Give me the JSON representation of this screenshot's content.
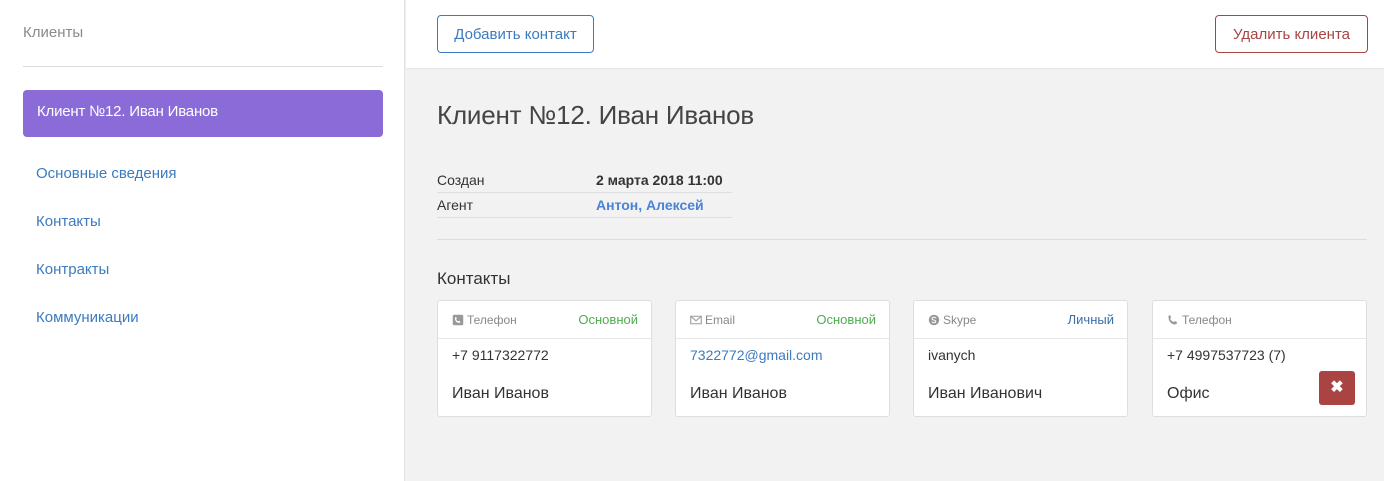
{
  "sidebar": {
    "title": "Клиенты",
    "active_client": "Клиент №12. Иван Иванов",
    "items": [
      {
        "label": "Основные сведения"
      },
      {
        "label": "Контакты"
      },
      {
        "label": "Контракты"
      },
      {
        "label": "Коммуникации"
      }
    ]
  },
  "toolbar": {
    "add_contact_label": "Добавить контакт",
    "delete_client_label": "Удалить клиента"
  },
  "main": {
    "title": "Клиент №12. Иван Иванов",
    "meta": {
      "created_label": "Создан",
      "created_value": "2 марта 2018 11:00",
      "agent_label": "Агент",
      "agent_1": "Антон",
      "agent_separator": ",",
      "agent_2": "Алексей"
    },
    "contacts_title": "Контакты",
    "contacts": [
      {
        "icon": "phone-icon",
        "type": "Телефон",
        "tag": "Основной",
        "tag_color": "#4cae4c",
        "value": "+7 9117322772",
        "name": "Иван Иванов"
      },
      {
        "icon": "envelope-icon",
        "type": "Email",
        "tag": "Основной",
        "tag_color": "#4cae4c",
        "value": "7322772@gmail.com",
        "name": "Иван Иванов"
      },
      {
        "icon": "skype-icon",
        "type": "Skype",
        "tag": "Личный",
        "tag_color": "#3a6fa8",
        "value": "ivanych",
        "name": "Иван Иванович"
      },
      {
        "icon": "phone-icon",
        "type": "Телефон",
        "tag": "",
        "value": "+7 4997537723 (7)",
        "name": "Офис",
        "remove_glyph": "✖"
      }
    ]
  },
  "colors": {
    "accent_purple": "#8a6bd8",
    "link_blue": "#3b7bbf",
    "danger_red": "#a94442",
    "success_green": "#4cae4c"
  }
}
